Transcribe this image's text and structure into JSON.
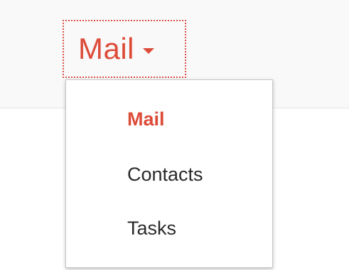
{
  "app_switcher": {
    "label": "Mail",
    "caret_icon": "caret-down-icon",
    "accent_color": "#dd4b39"
  },
  "menu": {
    "items": [
      {
        "label": "Mail",
        "selected": true
      },
      {
        "label": "Contacts",
        "selected": false
      },
      {
        "label": "Tasks",
        "selected": false
      }
    ]
  }
}
